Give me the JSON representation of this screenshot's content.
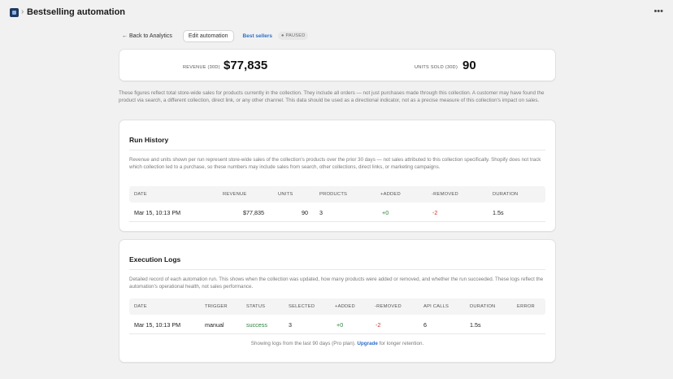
{
  "header": {
    "title": "Bestselling automation",
    "app_icon": "automation-app-icon",
    "separator": "›",
    "more_icon": "more-horizontal-icon"
  },
  "toolbar": {
    "back_label": "← Back to Analytics",
    "edit_label": "Edit automation",
    "collection_label": "Best sellers",
    "status_label": "● PAUSED"
  },
  "summary": {
    "revenue_label": "REVENUE (30D)",
    "revenue_value": "$77,835",
    "units_label": "UNITS SOLD (30D)",
    "units_value": "90"
  },
  "disclaimer": "These figures reflect total store-wide sales for products currently in the collection. They include all orders — not just purchases made through this collection. A customer may have found the product via search, a different collection, direct link, or any other channel. This data should be used as a directional indicator, not as a precise measure of this collection's impact on sales.",
  "run_history": {
    "title": "Run History",
    "description": "Revenue and units shown per run represent store-wide sales of the collection's products over the prior 30 days — not sales attributed to this collection specifically. Shopify does not track which collection led to a purchase, so these numbers may include sales from search, other collections, direct links, or marketing campaigns.",
    "columns": [
      "DATE",
      "REVENUE",
      "UNITS",
      "PRODUCTS",
      "+ADDED",
      "-REMOVED",
      "DURATION"
    ],
    "rows": [
      {
        "date": "Mar 15, 10:13 PM",
        "revenue": "$77,835",
        "units": "90",
        "products": "3",
        "added": "+0",
        "removed": "-2",
        "duration": "1.5s"
      }
    ]
  },
  "execution_logs": {
    "title": "Execution Logs",
    "description": "Detailed record of each automation run. This shows when the collection was updated, how many products were added or removed, and whether the run succeeded. These logs reflect the automation's operational health, not sales performance.",
    "columns": [
      "DATE",
      "TRIGGER",
      "STATUS",
      "SELECTED",
      "+ADDED",
      "-REMOVED",
      "API CALLS",
      "DURATION",
      "ERROR"
    ],
    "rows": [
      {
        "date": "Mar 15, 10:13 PM",
        "trigger": "manual",
        "status": "success",
        "selected": "3",
        "added": "+0",
        "removed": "-2",
        "api_calls": "6",
        "duration": "1.5s",
        "error": ""
      }
    ],
    "footnote_prefix": "Showing logs from the last 90 days (Pro plan).",
    "footnote_link": "Upgrade",
    "footnote_suffix": "for longer retention."
  },
  "colors": {
    "accent": "#2c6ecb",
    "success": "#2e8540",
    "danger": "#c8372d",
    "background": "#f1f1f1"
  }
}
